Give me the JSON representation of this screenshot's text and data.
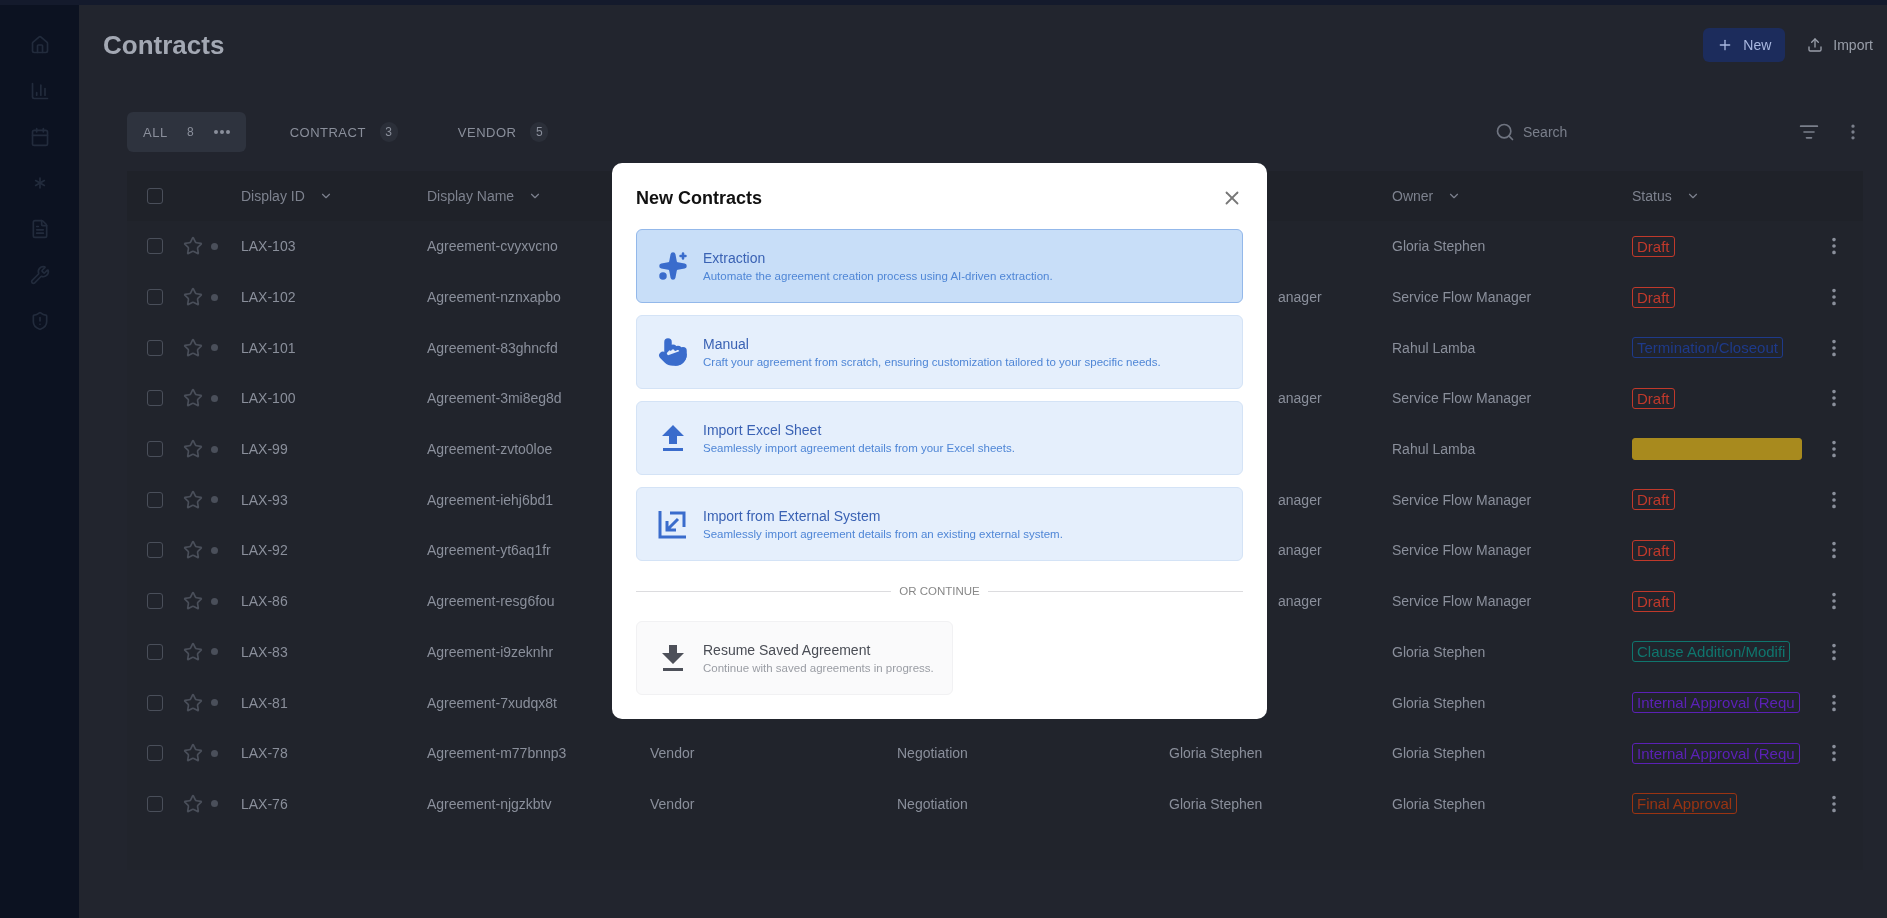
{
  "page": {
    "title": "Contracts",
    "new_button": "New",
    "import_button": "Import"
  },
  "tabs": [
    {
      "label": "ALL",
      "count": "8",
      "selected": true
    },
    {
      "label": "CONTRACT",
      "count": "3",
      "selected": false
    },
    {
      "label": "VENDOR",
      "count": "5",
      "selected": false
    }
  ],
  "search": {
    "placeholder": "Search"
  },
  "table": {
    "all_checked": false,
    "columns": [
      "Display ID",
      "Display Name",
      "Owner",
      "Status"
    ],
    "rows": [
      {
        "checked": false,
        "id": "LAX-103",
        "name": "Agreement-cvyxvcno",
        "owner": "Gloria Stephen",
        "status": {
          "label": "Draft",
          "color": "#c0392b"
        }
      },
      {
        "checked": false,
        "id": "LAX-102",
        "name": "Agreement-nznxapbo",
        "column_5": "anager",
        "partial": true,
        "owner": "Service Flow Manager",
        "status": {
          "label": "Draft",
          "color": "#c0392b"
        }
      },
      {
        "checked": false,
        "id": "LAX-101",
        "name": "Agreement-83ghncfd",
        "owner": "Rahul Lamba",
        "status": {
          "label": "Termination/Closeout",
          "color": "#1e3a8a"
        }
      },
      {
        "checked": false,
        "id": "LAX-100",
        "name": "Agreement-3mi8eg8d",
        "column_5": "anager",
        "partial": true,
        "owner": "Service Flow Manager",
        "status": {
          "label": "Draft",
          "color": "#c0392b"
        }
      },
      {
        "checked": false,
        "id": "LAX-99",
        "name": "Agreement-zvto0loe",
        "owner": "Rahul Lamba",
        "status": {
          "color": "#a88a1e"
        }
      },
      {
        "checked": false,
        "id": "LAX-93",
        "name": "Agreement-iehj6bd1",
        "column_5": "anager",
        "partial": true,
        "owner": "Service Flow Manager",
        "status": {
          "label": "Draft",
          "color": "#c0392b"
        }
      },
      {
        "checked": false,
        "id": "LAX-92",
        "name": "Agreement-yt6aq1fr",
        "column_5": "anager",
        "partial": true,
        "owner": "Service Flow Manager",
        "status": {
          "label": "Draft",
          "color": "#c0392b"
        }
      },
      {
        "checked": false,
        "id": "LAX-86",
        "name": "Agreement-resg6fou",
        "column_5": "anager",
        "partial": true,
        "owner": "Service Flow Manager",
        "status": {
          "label": "Draft",
          "color": "#c0392b"
        }
      },
      {
        "checked": false,
        "id": "LAX-83",
        "name": "Agreement-i9zeknhr",
        "owner": "Gloria Stephen",
        "status": {
          "label": "Clause Addition/Modifi",
          "color": "#0f766e"
        }
      },
      {
        "checked": false,
        "id": "LAX-81",
        "name": "Agreement-7xudqx8t",
        "owner": "Gloria Stephen",
        "status": {
          "label": "Internal Approval (Requ",
          "color": "#5b21b6"
        }
      },
      {
        "checked": false,
        "id": "LAX-78",
        "name": "Agreement-m77bnnp3",
        "column_3": "Vendor",
        "column_4": "Negotiation",
        "column_5": "Gloria Stephen",
        "owner": "Gloria Stephen",
        "status": {
          "label": "Internal Approval (Requ",
          "color": "#5b21b6"
        }
      },
      {
        "checked": false,
        "id": "LAX-76",
        "name": "Agreement-njgzkbtv",
        "column_3": "Vendor",
        "column_4": "Negotiation",
        "column_5": "Gloria Stephen",
        "owner": "Gloria Stephen",
        "status": {
          "label": "Final Approval",
          "color": "#9a3412"
        }
      }
    ]
  },
  "dialog": {
    "title": "New Contracts",
    "divider": "OR CONTINUE",
    "options": [
      {
        "kind": "extraction",
        "title": "Extraction",
        "description": "Automate the agreement creation process using AI-driven extraction.",
        "selected": true
      },
      {
        "kind": "manual",
        "title": "Manual",
        "description": "Craft your agreement from scratch, ensuring customization tailored to your specific needs.",
        "selected": false
      },
      {
        "kind": "excel",
        "title": "Import Excel Sheet",
        "description": "Seamlessly import agreement details from your Excel sheets.",
        "selected": false
      },
      {
        "kind": "external",
        "title": "Import from External System",
        "description": "Seamlessly import agreement details from an existing external system.",
        "selected": false
      }
    ],
    "resume": {
      "title": "Resume Saved Agreement",
      "description": "Continue with saved agreements in progress."
    }
  }
}
